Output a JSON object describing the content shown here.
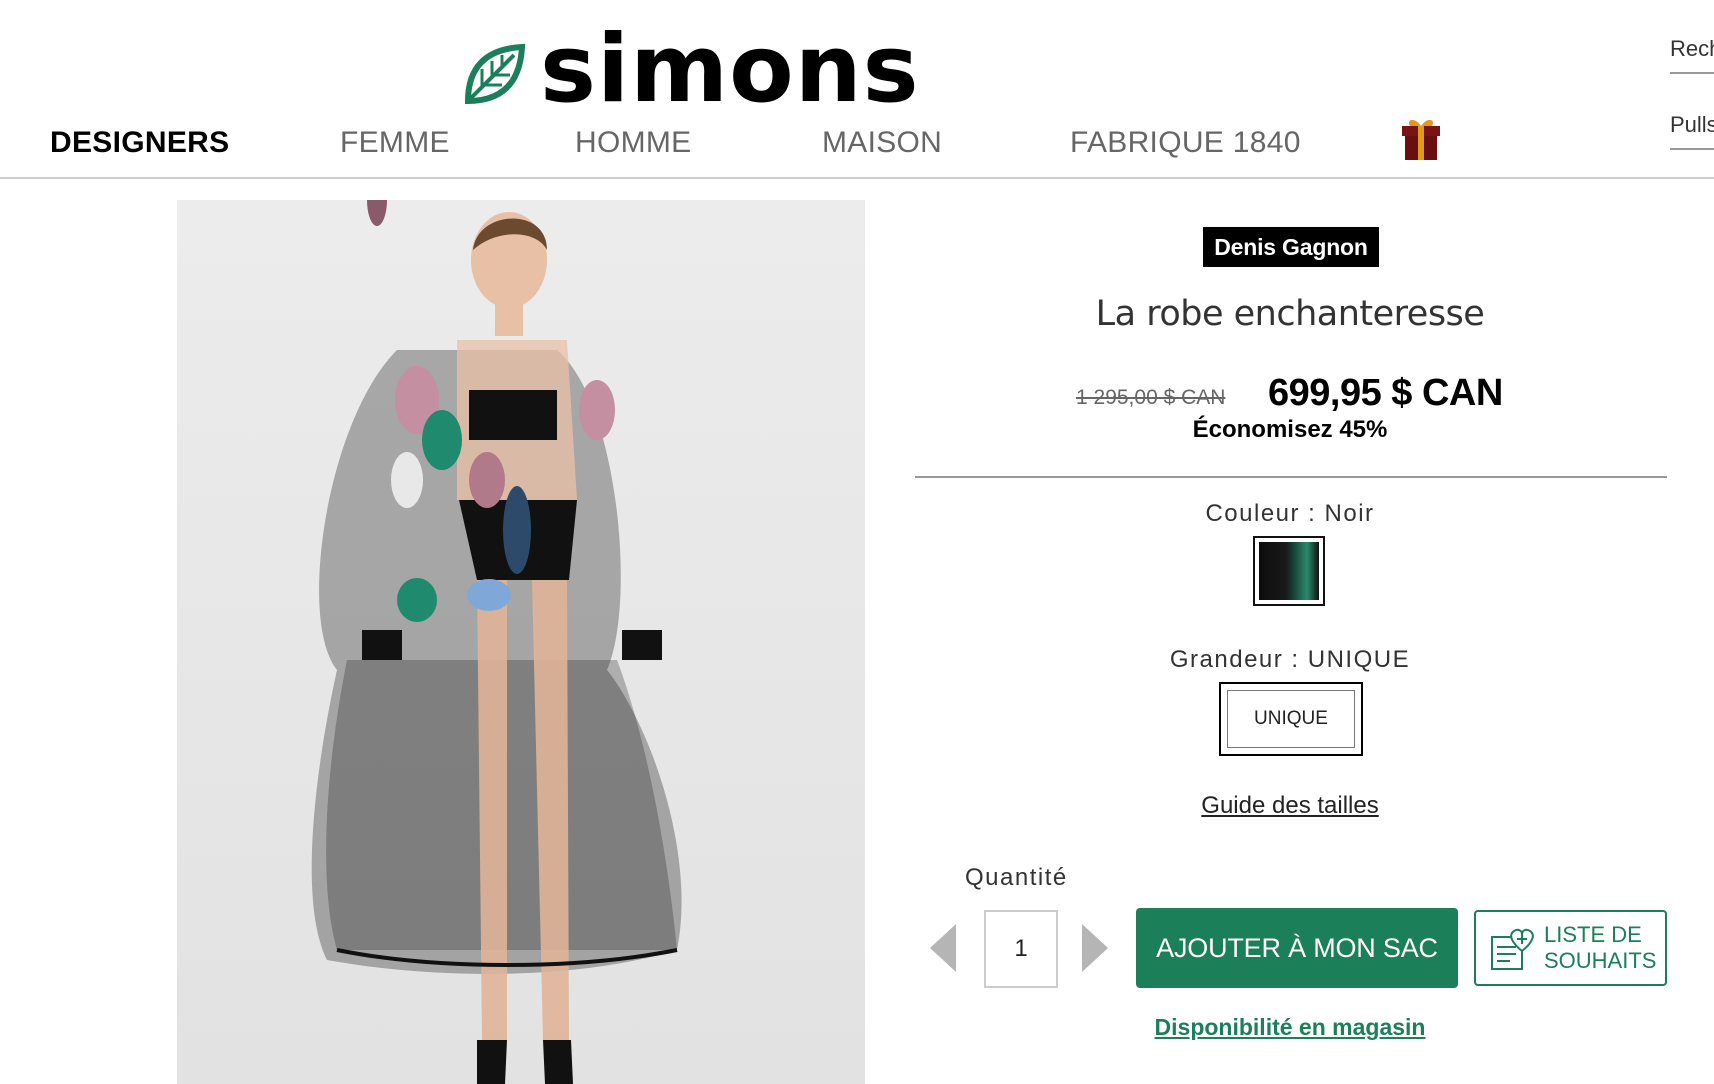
{
  "header": {
    "logo_text": "simons",
    "search_stub": "Rech",
    "pulls_stub": "Pulls"
  },
  "nav": {
    "items": [
      {
        "label": "DESIGNERS",
        "active": true
      },
      {
        "label": "FEMME",
        "active": false
      },
      {
        "label": "HOMME",
        "active": false
      },
      {
        "label": "MAISON",
        "active": false
      },
      {
        "label": "FABRIQUE 1840",
        "active": false
      }
    ],
    "gift_icon": "gift-icon"
  },
  "product": {
    "brand": "Denis Gagnon",
    "title": "La robe enchanteresse",
    "old_price": "1 295,00 $ CAN",
    "new_price": "699,95 $ CAN",
    "savings": "Économisez 45%",
    "color_label": "Couleur : Noir",
    "size_label": "Grandeur : UNIQUE",
    "size_option": "UNIQUE",
    "size_guide": "Guide des tailles",
    "quantity_label": "Quantité",
    "quantity_value": "1",
    "add_to_bag": "AJOUTER À MON SAC",
    "wishlist_line1": "LISTE DE",
    "wishlist_line2": "SOUHAITS",
    "store_availability": "Disponibilité en magasin"
  },
  "colors": {
    "brand_green": "#1b7f5a",
    "badge_black": "#000000"
  }
}
